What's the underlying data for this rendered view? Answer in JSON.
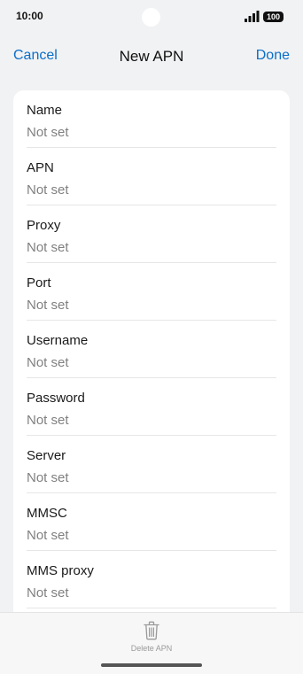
{
  "status_bar": {
    "time": "10:00",
    "battery": "100"
  },
  "nav": {
    "cancel": "Cancel",
    "title": "New APN",
    "done": "Done"
  },
  "fields": [
    {
      "label": "Name",
      "value": "Not set"
    },
    {
      "label": "APN",
      "value": "Not set"
    },
    {
      "label": "Proxy",
      "value": "Not set"
    },
    {
      "label": "Port",
      "value": "Not set"
    },
    {
      "label": "Username",
      "value": "Not set"
    },
    {
      "label": "Password",
      "value": "Not set"
    },
    {
      "label": "Server",
      "value": "Not set"
    },
    {
      "label": "MMSC",
      "value": "Not set"
    },
    {
      "label": "MMS proxy",
      "value": "Not set"
    }
  ],
  "bottom": {
    "delete_label": "Delete APN"
  },
  "colors": {
    "accent": "#0a6fc9",
    "background": "#f1f2f4",
    "card": "#ffffff",
    "secondary_text": "#808080"
  }
}
